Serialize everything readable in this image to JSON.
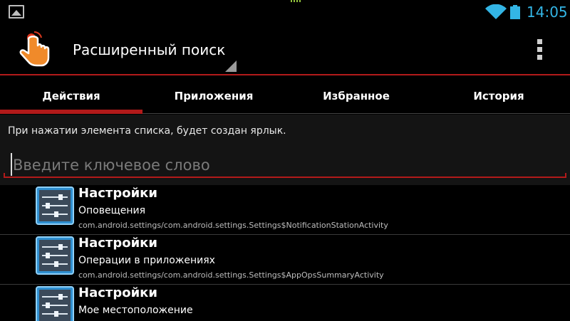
{
  "statusbar": {
    "time": "14:05",
    "icons": [
      "gallery-notification-icon",
      "wifi-icon",
      "battery-icon"
    ],
    "accent": "#33b5e5"
  },
  "actionbar": {
    "app_icon": "tap-hand-icon",
    "title": "Расширенный поиск",
    "menu_icon": "overflow-menu-icon",
    "accent": "#b21a1a"
  },
  "tabs": [
    {
      "label": "Действия",
      "active": true
    },
    {
      "label": "Приложения",
      "active": false
    },
    {
      "label": "Избранное",
      "active": false
    },
    {
      "label": "История",
      "active": false
    }
  ],
  "hint": "При нажатии элемента списка, будет создан ярлык.",
  "search": {
    "value": "",
    "placeholder": "Введите ключевое слово"
  },
  "items": [
    {
      "icon": "settings-icon",
      "title": "Настройки",
      "subtitle": "Оповещения",
      "package": "com.android.settings/com.android.settings.Settings$NotificationStationActivity"
    },
    {
      "icon": "settings-icon",
      "title": "Настройки",
      "subtitle": "Операции в приложениях",
      "package": "com.android.settings/com.android.settings.Settings$AppOpsSummaryActivity"
    },
    {
      "icon": "settings-icon",
      "title": "Настройки",
      "subtitle": "Мое местоположение",
      "package": ""
    }
  ]
}
